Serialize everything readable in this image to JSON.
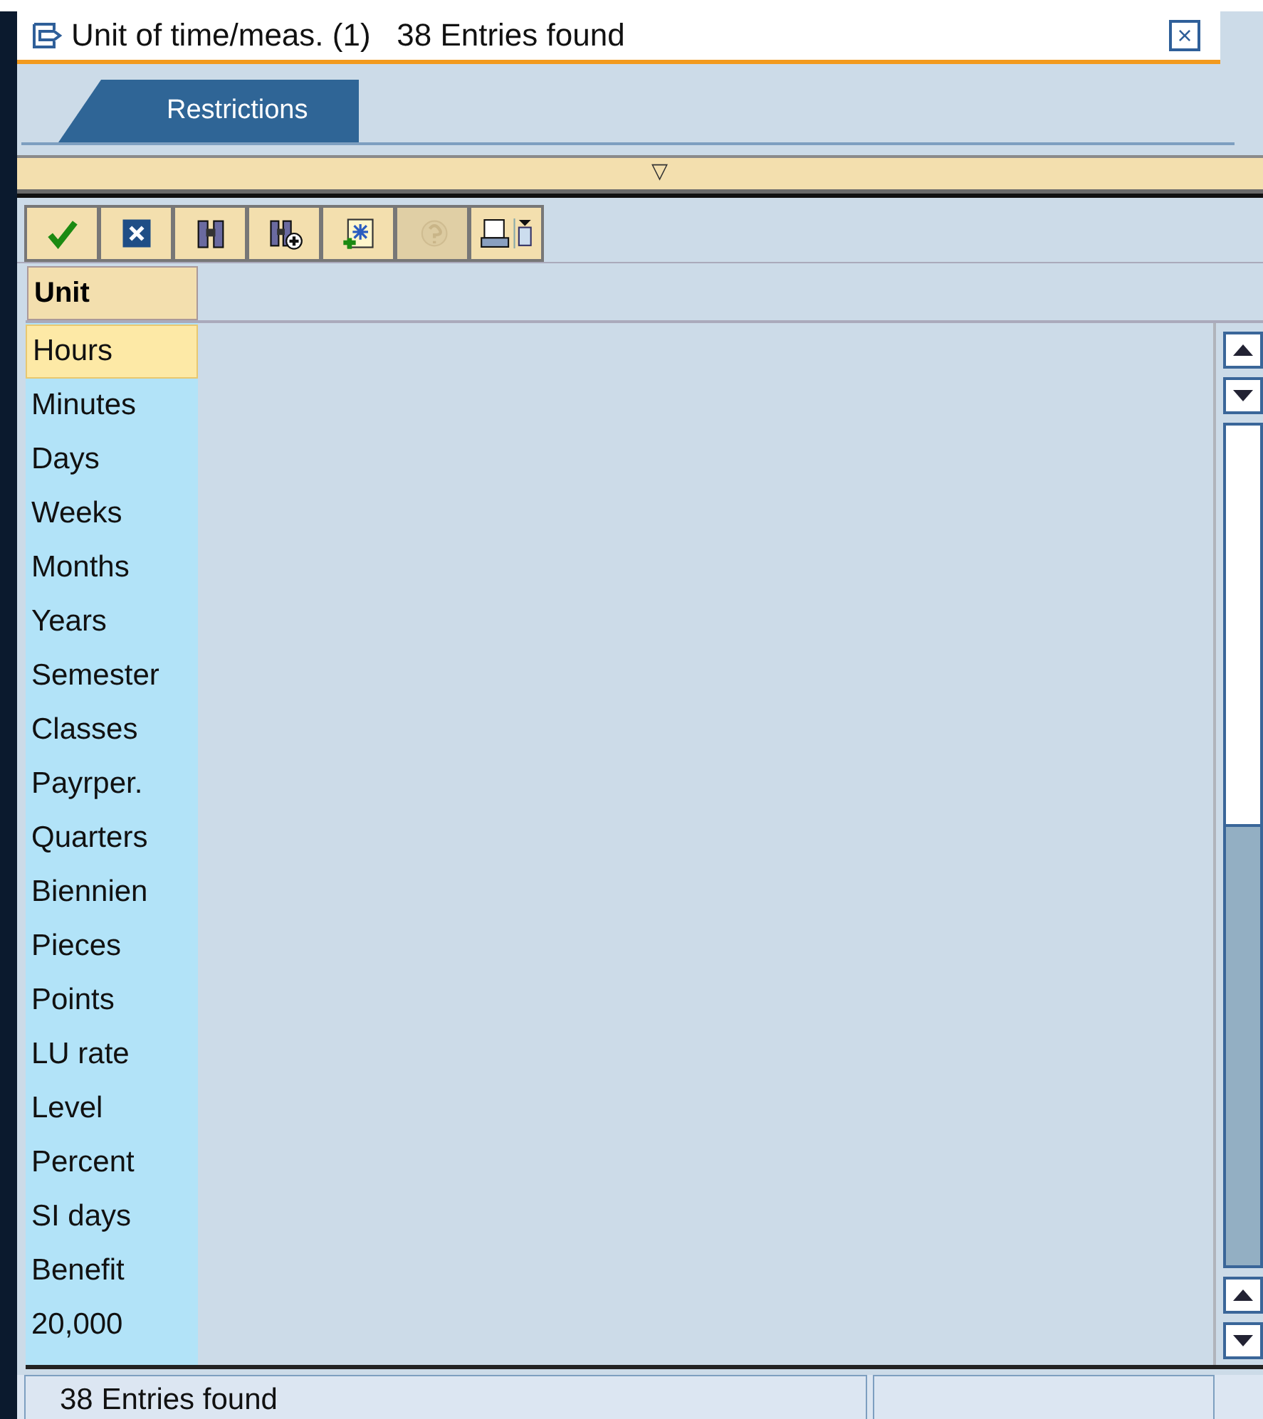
{
  "window": {
    "title": "Unit of time/meas. (1)   38 Entries found",
    "close_symbol": "×"
  },
  "tabs": [
    {
      "label": "Restrictions",
      "selected": true
    }
  ],
  "collapse_symbol": "▽",
  "toolbar": [
    {
      "kind": "check",
      "disabled": false
    },
    {
      "kind": "cancel",
      "disabled": false
    },
    {
      "kind": "find",
      "disabled": false
    },
    {
      "kind": "findnext",
      "disabled": false
    },
    {
      "kind": "newsel",
      "disabled": false
    },
    {
      "kind": "help",
      "disabled": true
    },
    {
      "kind": "print",
      "disabled": false
    }
  ],
  "table": {
    "columns": [
      "Unit"
    ],
    "rows": [
      {
        "unit": "Hours",
        "selected": true
      },
      {
        "unit": "Minutes",
        "selected": false
      },
      {
        "unit": "Days",
        "selected": false
      },
      {
        "unit": "Weeks",
        "selected": false
      },
      {
        "unit": "Months",
        "selected": false
      },
      {
        "unit": "Years",
        "selected": false
      },
      {
        "unit": "Semester",
        "selected": false
      },
      {
        "unit": "Classes",
        "selected": false
      },
      {
        "unit": "Payrper.",
        "selected": false
      },
      {
        "unit": "Quarters",
        "selected": false
      },
      {
        "unit": "Biennien",
        "selected": false
      },
      {
        "unit": "Pieces",
        "selected": false
      },
      {
        "unit": "Points",
        "selected": false
      },
      {
        "unit": "LU rate",
        "selected": false
      },
      {
        "unit": "Level",
        "selected": false
      },
      {
        "unit": "Percent",
        "selected": false
      },
      {
        "unit": "SI days",
        "selected": false
      },
      {
        "unit": "Benefit",
        "selected": false
      },
      {
        "unit": "20,000",
        "selected": false
      }
    ]
  },
  "status_bar": {
    "message": "38 Entries found"
  }
}
